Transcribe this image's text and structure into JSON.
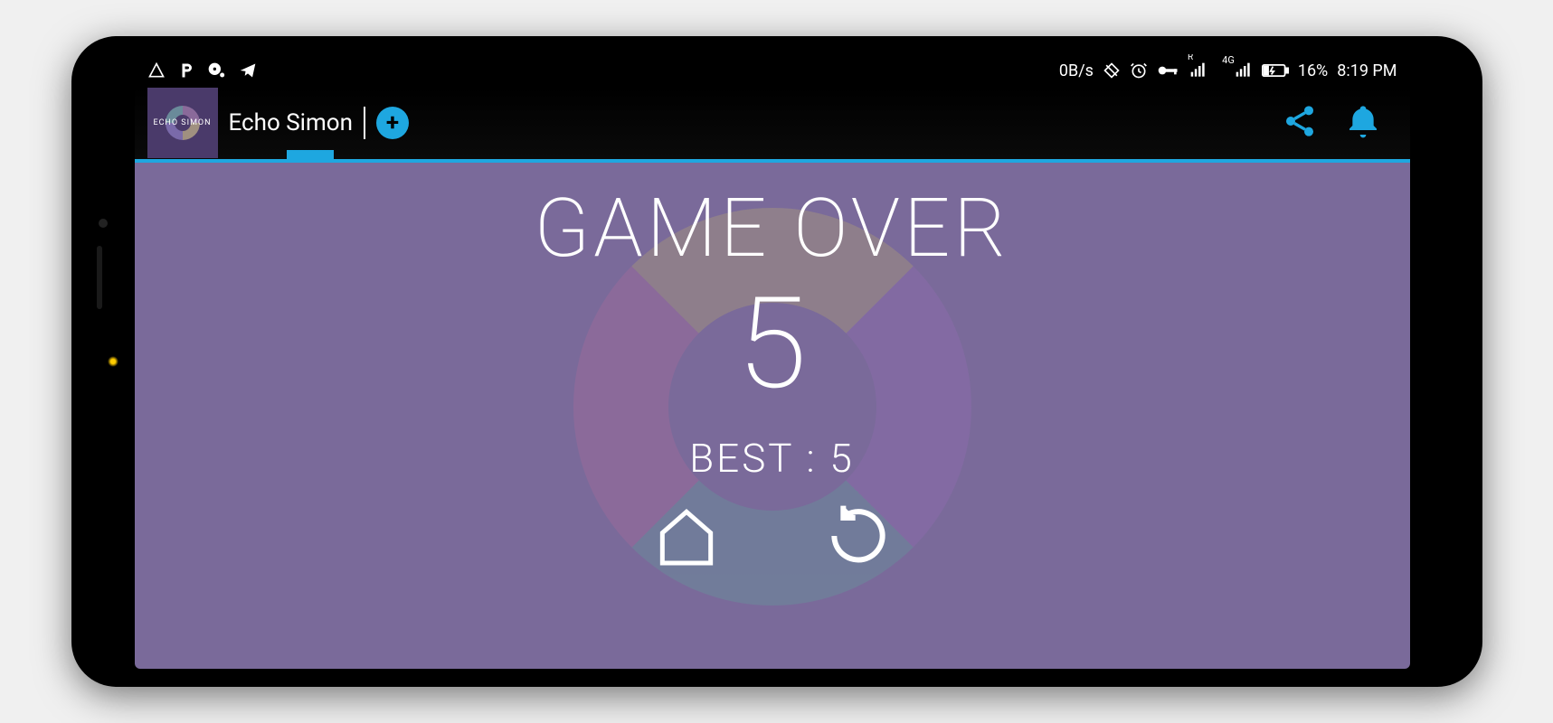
{
  "status_bar": {
    "data_speed": "0B/s",
    "battery_pct": "16%",
    "time": "8:19 PM",
    "network_label": "4G",
    "roaming_label": "R"
  },
  "app_bar": {
    "title": "Echo Simon",
    "logo_text": "ECHO SIMON"
  },
  "game": {
    "game_over_label": "GAME OVER",
    "score": "5",
    "best_label": "BEST : 5"
  },
  "colors": {
    "accent": "#1ea7e0",
    "game_bg": "#7a6a9a",
    "ring_tl": "#9a6a9a",
    "ring_tr": "#a09080",
    "ring_br": "#8a6aaa",
    "ring_bl": "#6a8a9a"
  }
}
